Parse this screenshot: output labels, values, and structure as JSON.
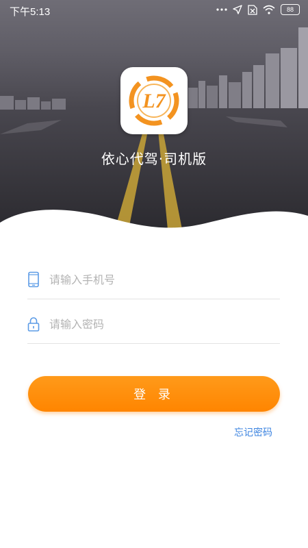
{
  "status_bar": {
    "time": "下午5:13",
    "battery": "88",
    "icons": [
      "more-dots-icon",
      "location-arrow-icon",
      "sim-off-icon",
      "wifi-icon",
      "battery-icon"
    ]
  },
  "app": {
    "name": "依心代驾·司机版",
    "logo_text": "L7",
    "logo_color": "#f39320"
  },
  "form": {
    "phone_placeholder": "请输入手机号",
    "phone_value": "",
    "password_placeholder": "请输入密码",
    "password_value": "",
    "login_label": "登 录",
    "forgot_label": "忘记密码"
  },
  "colors": {
    "accent": "#ff8a00",
    "link": "#3d84e0",
    "icon": "#5b9be6"
  }
}
